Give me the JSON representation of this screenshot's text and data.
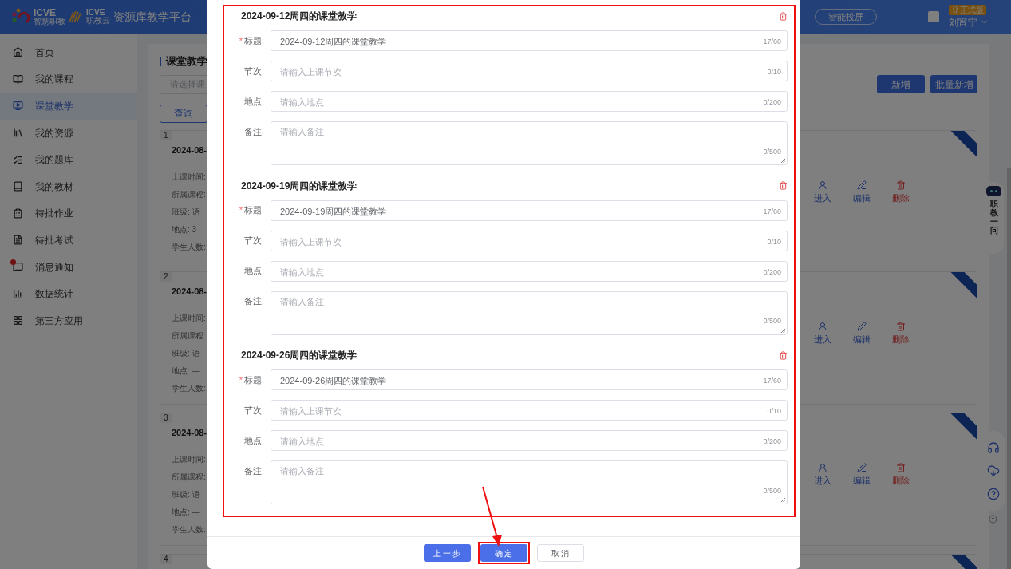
{
  "header": {
    "logo_1": {
      "brand": "ICVE",
      "sub": "智慧职教"
    },
    "logo_2": {
      "brand": "ICVE",
      "sub": "职教云"
    },
    "platform_title": "资源库教学平台",
    "cast_button": "智能投屏",
    "edition_badge": "正式版",
    "user_name": "刘宵宁"
  },
  "sidebar": {
    "items": [
      {
        "label": "首页",
        "selected": false,
        "unread": false
      },
      {
        "label": "我的课程",
        "selected": false,
        "unread": false
      },
      {
        "label": "课堂教学",
        "selected": true,
        "unread": false
      },
      {
        "label": "我的资源",
        "selected": false,
        "unread": false
      },
      {
        "label": "我的题库",
        "selected": false,
        "unread": false
      },
      {
        "label": "我的教材",
        "selected": false,
        "unread": false
      },
      {
        "label": "待批作业",
        "selected": false,
        "unread": false
      },
      {
        "label": "待批考试",
        "selected": false,
        "unread": false
      },
      {
        "label": "消息通知",
        "selected": false,
        "unread": true
      },
      {
        "label": "数据统计",
        "selected": false,
        "unread": false
      },
      {
        "label": "第三方应用",
        "selected": false,
        "unread": false
      }
    ]
  },
  "page": {
    "title": "课堂教学",
    "course_select": {
      "placeholder": "请选择课"
    },
    "query_button": "查询",
    "add_button": "新增",
    "batch_add_button": "批量新增"
  },
  "cards": [
    {
      "index": "1",
      "title": "2024-08-",
      "fields": [
        "上课时间:",
        "所属课程:",
        "班级: 语",
        "地点: 3",
        "学生人数:"
      ],
      "actions": [
        "进入",
        "编辑",
        "删除"
      ]
    },
    {
      "index": "2",
      "title": "2024-08-",
      "fields": [
        "上课时间:",
        "所属课程:",
        "班级: 语",
        "地点: —",
        "学生人数:"
      ],
      "actions": [
        "进入",
        "编辑",
        "删除"
      ]
    },
    {
      "index": "3",
      "title": "2024-08-",
      "fields": [
        "上课时间:",
        "所属课程:",
        "班级: 语",
        "地点: —",
        "学生人数:"
      ],
      "actions": [
        "进入",
        "编辑",
        "删除"
      ]
    },
    {
      "index": "4"
    }
  ],
  "assistant": {
    "label": "职教一问"
  },
  "dialog": {
    "sections": [
      {
        "title": "2024-09-12周四的课堂教学",
        "fields": [
          {
            "kind": "input",
            "label": "标题:",
            "mark": "*",
            "value": "2024-09-12周四的课堂教学",
            "counter": "17/60"
          },
          {
            "kind": "input",
            "label": "节次:",
            "placeholder": "请输入上课节次",
            "counter": "0/10"
          },
          {
            "kind": "input",
            "label": "地点:",
            "placeholder": "请输入地点",
            "counter": "0/200"
          },
          {
            "kind": "textarea",
            "label": "备注:",
            "placeholder": "请输入备注",
            "counter": "0/500"
          }
        ]
      },
      {
        "title": "2024-09-19周四的课堂教学",
        "fields": [
          {
            "kind": "input",
            "label": "标题:",
            "mark": "*",
            "value": "2024-09-19周四的课堂教学",
            "counter": "17/60"
          },
          {
            "kind": "input",
            "label": "节次:",
            "placeholder": "请输入上课节次",
            "counter": "0/10"
          },
          {
            "kind": "input",
            "label": "地点:",
            "placeholder": "请输入地点",
            "counter": "0/200"
          },
          {
            "kind": "textarea",
            "label": "备注:",
            "placeholder": "请输入备注",
            "counter": "0/500"
          }
        ]
      },
      {
        "title": "2024-09-26周四的课堂教学",
        "fields": [
          {
            "kind": "input",
            "label": "标题:",
            "mark": "*",
            "value": "2024-09-26周四的课堂教学",
            "counter": "17/60"
          },
          {
            "kind": "input",
            "label": "节次:",
            "placeholder": "请输入上课节次",
            "counter": "0/10"
          },
          {
            "kind": "input",
            "label": "地点:",
            "placeholder": "请输入地点",
            "counter": "0/200"
          },
          {
            "kind": "textarea",
            "label": "备注:",
            "placeholder": "请输入备注",
            "counter": "0/500"
          }
        ]
      }
    ],
    "buttons": [
      {
        "label": "上一步",
        "kind": "primary",
        "highlighted": false
      },
      {
        "label": "确定",
        "kind": "primary",
        "highlighted": true
      },
      {
        "label": "取消",
        "kind": "default",
        "highlighted": false
      }
    ]
  }
}
